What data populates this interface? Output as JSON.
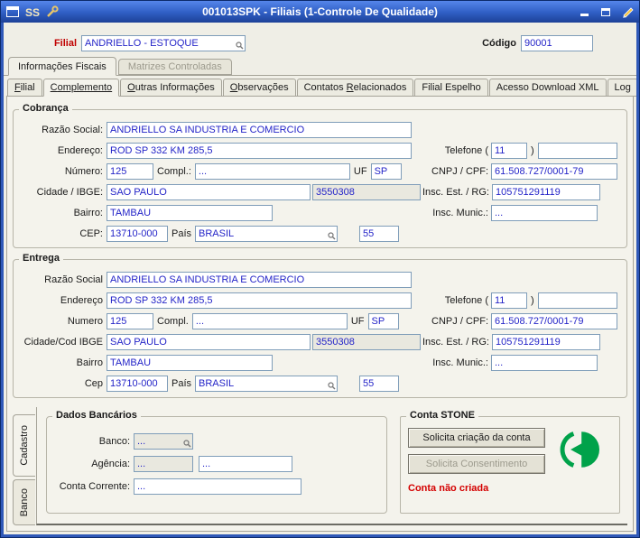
{
  "colors": {
    "titlebar_blue": "#2f58b8",
    "field_text_blue": "#2424c8",
    "label_red": "#c00000",
    "status_red": "#d40000",
    "stone_green": "#00a24a"
  },
  "window": {
    "title": "001013SPK - Filiais (1-Controle De Qualidade)"
  },
  "header": {
    "filial_label": "Filial",
    "filial_value": "ANDRIELLO - ESTOQUE",
    "codigo_label": "Código",
    "codigo_value": "90001"
  },
  "top_tabs": [
    {
      "label": "Informações Fiscais"
    },
    {
      "label": "Matrizes Controladas"
    }
  ],
  "tabs": [
    {
      "pre": "",
      "hot": "F",
      "post": "ilial"
    },
    {
      "pre": "",
      "hot": "C",
      "post": "omplemento"
    },
    {
      "pre": "",
      "hot": "O",
      "post": "utras Informações"
    },
    {
      "pre": "",
      "hot": "O",
      "post": "bservações"
    },
    {
      "pre": "Contatos ",
      "hot": "R",
      "post": "elacionados"
    },
    {
      "pre": "Filial Espelho",
      "hot": "",
      "post": ""
    },
    {
      "pre": "Acesso Download XML",
      "hot": "",
      "post": ""
    },
    {
      "pre": "Log",
      "hot": "",
      "post": ""
    }
  ],
  "cobranca": {
    "title": "Cobrança",
    "razao_label": "Razão Social:",
    "razao_value": "ANDRIELLO SA INDUSTRIA E COMERCIO",
    "endereco_label": "Endereço:",
    "endereco_value": "ROD SP 332 KM 285,5",
    "telefone_label": "Telefone (",
    "telefone_ddd": "11",
    "telefone_close": ")",
    "telefone_numero": "",
    "numero_label": "Número:",
    "numero_value": "125",
    "compl_label": "Compl.:",
    "compl_value": "...",
    "uf_label": "UF",
    "uf_value": "SP",
    "cnpj_label": "CNPJ / CPF:",
    "cnpj_value": "61.508.727/0001-79",
    "cidade_label": "Cidade / IBGE:",
    "cidade_value": "SAO PAULO",
    "ibge_value": "3550308",
    "ie_label": "Insc. Est. / RG:",
    "ie_value": "105751291119",
    "bairro_label": "Bairro:",
    "bairro_value": "TAMBAU",
    "im_label": "Insc. Munic.:",
    "im_value": "...",
    "cep_label": "CEP:",
    "cep_value": "13710-000",
    "pais_label": "País",
    "pais_value": "BRASIL",
    "ddi_value": "55"
  },
  "entrega": {
    "title": "Entrega",
    "razao_label": "Razão Social",
    "razao_value": "ANDRIELLO SA INDUSTRIA E COMERCIO",
    "endereco_label": "Endereço",
    "endereco_value": "ROD SP 332 KM 285,5",
    "telefone_label": "Telefone (",
    "telefone_ddd": "11",
    "telefone_close": ")",
    "telefone_numero": "",
    "numero_label": "Numero",
    "numero_value": "125",
    "compl_label": "Compl.",
    "compl_value": "...",
    "uf_label": "UF",
    "uf_value": "SP",
    "cnpj_label": "CNPJ / CPF:",
    "cnpj_value": "61.508.727/0001-79",
    "cidade_label": "Cidade/Cod IBGE",
    "cidade_value": "SAO PAULO",
    "ibge_value": "3550308",
    "ie_label": "Insc. Est. / RG:",
    "ie_value": "105751291119",
    "bairro_label": "Bairro",
    "bairro_value": "TAMBAU",
    "im_label": "Insc. Munic.:",
    "im_value": "...",
    "cep_label": "Cep",
    "cep_value": "13710-000",
    "pais_label": "País",
    "pais_value": "BRASIL",
    "ddi_value": "55"
  },
  "bottom": {
    "side_tabs": [
      "Cadastro",
      "Banco"
    ],
    "dados_bancarios": {
      "title": "Dados Bancários",
      "banco_label": "Banco:",
      "banco_value": "...",
      "agencia_label": "Agência:",
      "agencia_value": "...",
      "agencia_conta": "...",
      "conta_label": "Conta Corrente:",
      "conta_value": "..."
    },
    "conta_stone": {
      "title": "Conta STONE",
      "solicitar_criacao": "Solicita criação da conta",
      "solicitar_consentimento": "Solicita Consentimento",
      "status": "Conta não criada"
    }
  }
}
